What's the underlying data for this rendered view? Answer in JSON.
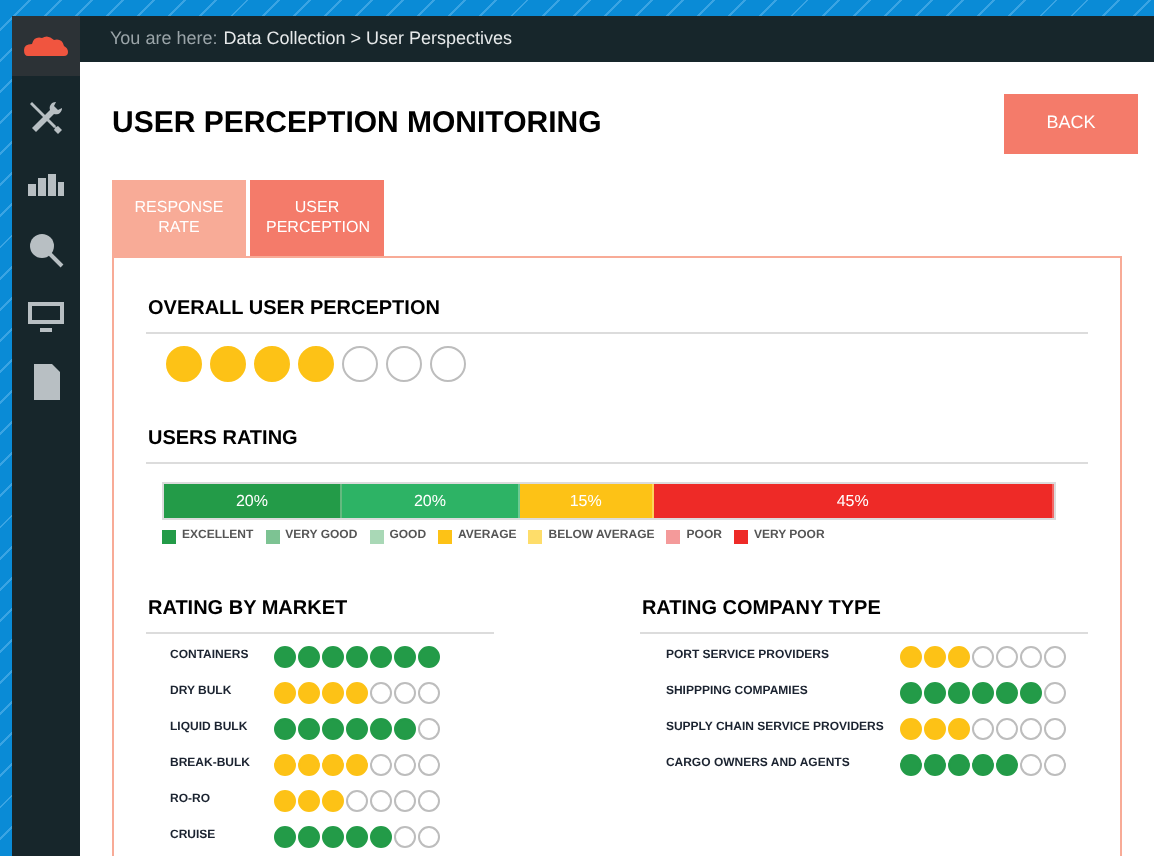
{
  "breadcrumb": {
    "prefix": "You are here:",
    "path": "Data Collection > User Perspectives"
  },
  "page_title": "USER PERCEPTION MONITORING",
  "back_button": "BACK",
  "tabs": [
    {
      "label": "RESPONSE RATE",
      "selected": false
    },
    {
      "label": "USER PERCEPTION",
      "selected": true
    }
  ],
  "overall": {
    "title": "OVERALL USER PERCEPTION",
    "stars": 4
  },
  "users_rating": {
    "title": "USERS RATING",
    "segments": [
      {
        "value": "20%",
        "color": "#239b48"
      },
      {
        "value": "20%",
        "color": "#2db365"
      },
      {
        "value": "15%",
        "color": "#fdc216"
      },
      {
        "value": "45%",
        "color": "#ee2a27"
      }
    ],
    "legend": [
      {
        "label": "EXCELLENT",
        "color": "#239b48"
      },
      {
        "label": "VERY GOOD",
        "color": "#7dc393"
      },
      {
        "label": "GOOD",
        "color": "#a9d8b6"
      },
      {
        "label": "AVERAGE",
        "color": "#fdc216"
      },
      {
        "label": "BELOW AVERAGE",
        "color": "#fedd6a"
      },
      {
        "label": "POOR",
        "color": "#f49a9a"
      },
      {
        "label": "VERY POOR",
        "color": "#ee2a27"
      }
    ]
  },
  "rating_by_market": {
    "title": "RATING BY MARKET",
    "rows": [
      {
        "label": "CONTAINERS",
        "stars": 7,
        "color": "#239b48"
      },
      {
        "label": "DRY BULK",
        "stars": 4,
        "color": "#fdc216"
      },
      {
        "label": "LIQUID BULK",
        "stars": 6,
        "color": "#239b48"
      },
      {
        "label": "BREAK-BULK",
        "stars": 4,
        "color": "#fdc216"
      },
      {
        "label": "RO-RO",
        "stars": 3,
        "color": "#fdc216"
      },
      {
        "label": "CRUISE",
        "stars": 5,
        "color": "#239b48"
      }
    ]
  },
  "rating_company_type": {
    "title": "RATING COMPANY TYPE",
    "rows": [
      {
        "label": "PORT SERVICE PROVIDERS",
        "stars": 3,
        "color": "#fdc216"
      },
      {
        "label": "SHIPPPING COMPAMIES",
        "stars": 6,
        "color": "#239b48"
      },
      {
        "label": "SUPPLY CHAIN SERVICE PROVIDERS",
        "stars": 3,
        "color": "#fdc216"
      },
      {
        "label": "CARGO OWNERS AND AGENTS",
        "stars": 5,
        "color": "#239b48"
      }
    ]
  }
}
